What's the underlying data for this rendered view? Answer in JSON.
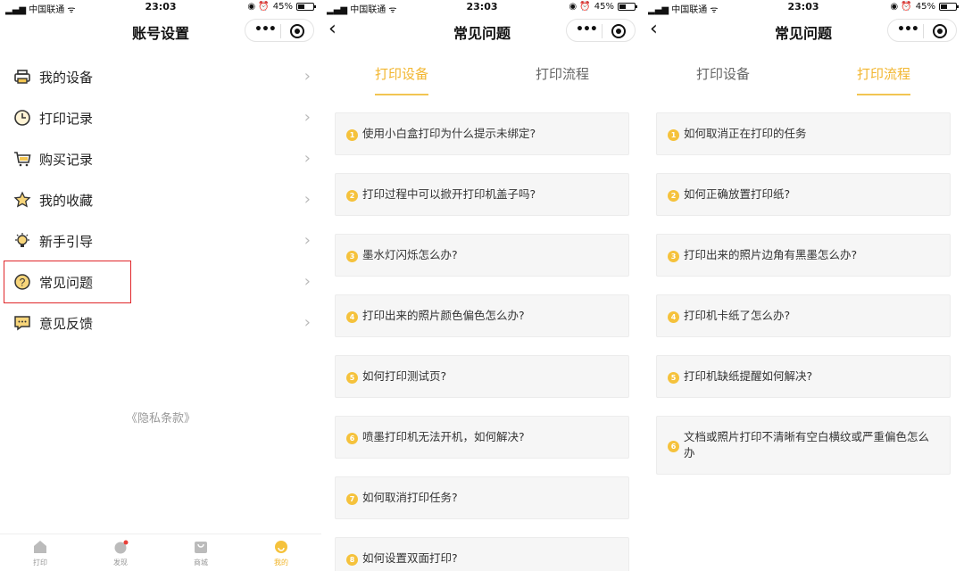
{
  "status": {
    "carrier": "中国联通",
    "time": "23:03",
    "battery": "45%",
    "battery_level": 0.45
  },
  "settings": {
    "title": "账号设置",
    "items": [
      {
        "label": "我的设备",
        "icon": "printer-icon"
      },
      {
        "label": "打印记录",
        "icon": "clock-icon"
      },
      {
        "label": "购买记录",
        "icon": "cart-icon"
      },
      {
        "label": "我的收藏",
        "icon": "star-icon"
      },
      {
        "label": "新手引导",
        "icon": "lightbulb-icon"
      },
      {
        "label": "常见问题",
        "icon": "question-icon"
      },
      {
        "label": "意见反馈",
        "icon": "chat-icon"
      }
    ],
    "privacy": "《隐私条款》",
    "tabbar": [
      {
        "label": "打印",
        "icon": "home-icon"
      },
      {
        "label": "发现",
        "icon": "discover-icon"
      },
      {
        "label": "商城",
        "icon": "shop-icon"
      },
      {
        "label": "我的",
        "icon": "profile-icon"
      }
    ]
  },
  "faq": {
    "title": "常见问题",
    "tabs": [
      "打印设备",
      "打印流程"
    ],
    "device_questions": [
      "使用小白盒打印为什么提示未绑定?",
      "打印过程中可以掀开打印机盖子吗?",
      "墨水灯闪烁怎么办?",
      "打印出来的照片颜色偏色怎么办?",
      "如何打印测试页?",
      "喷墨打印机无法开机，如何解决?",
      "如何取消打印任务?",
      "如何设置双面打印?"
    ],
    "process_questions": [
      "如何取消正在打印的任务",
      "如何正确放置打印纸?",
      "打印出来的照片边角有黑墨怎么办?",
      "打印机卡纸了怎么办?",
      "打印机缺纸提醒如何解决?",
      "文档或照片打印不清晰有空白横纹或严重偏色怎么办"
    ]
  },
  "colors": {
    "accent": "#f2b630",
    "highlight_box": "#e0262a"
  }
}
